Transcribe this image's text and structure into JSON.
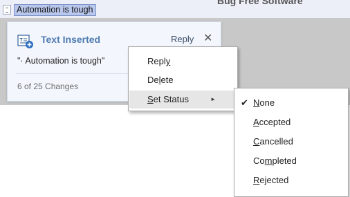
{
  "document": {
    "header_text": "Bug Free Software",
    "selected_text": "Automation is tough"
  },
  "card": {
    "title": "Text Inserted",
    "reply_label": "Reply",
    "close_glyph": "✕",
    "quote": "\"· Automation is tough\"",
    "change_count": "6 of 25 Changes"
  },
  "context_menu": {
    "items": [
      {
        "pre": "Repl",
        "key": "y",
        "post": ""
      },
      {
        "pre": "De",
        "key": "l",
        "post": "ete"
      },
      {
        "pre": "",
        "key": "S",
        "post": "et Status"
      }
    ],
    "submenu_arrow": "►"
  },
  "status_menu": {
    "check_glyph": "✔",
    "selected": "None",
    "items": [
      {
        "pre": "",
        "key": "N",
        "post": "one"
      },
      {
        "pre": "",
        "key": "A",
        "post": "ccepted"
      },
      {
        "pre": "",
        "key": "C",
        "post": "ancelled"
      },
      {
        "pre": "Co",
        "key": "m",
        "post": "pleted"
      },
      {
        "pre": "",
        "key": "R",
        "post": "ejected"
      }
    ]
  },
  "colors": {
    "accent_title": "#4f7bb0",
    "selection": "#b9c7ec",
    "menu_hover": "#e6e6e6"
  }
}
